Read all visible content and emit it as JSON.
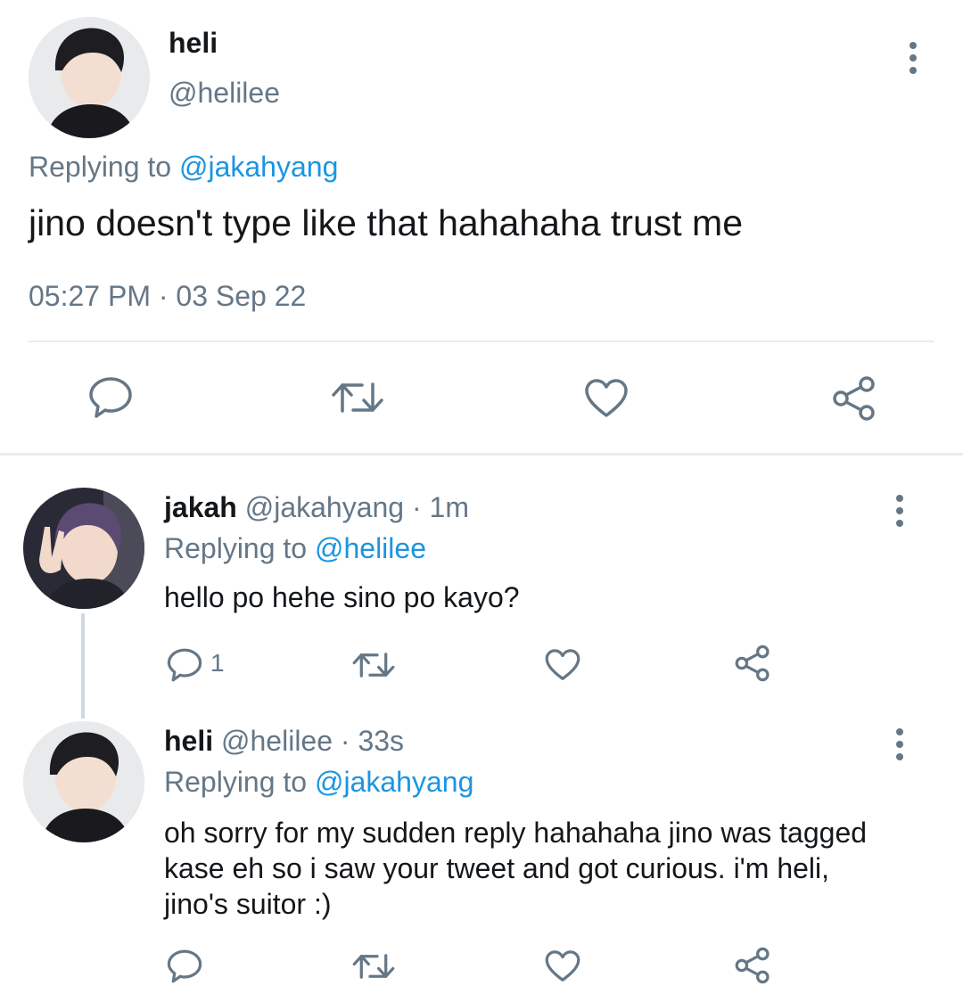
{
  "main_tweet": {
    "display_name": "heli",
    "handle": "@helilee",
    "replying_prefix": "Replying to",
    "replying_handle": "@jakahyang",
    "text": "jino doesn't type like that hahahaha trust me",
    "timestamp": "05:27 PM · 03 Sep 22",
    "actions": [
      "reply-icon",
      "retweet-icon",
      "like-icon",
      "share-icon"
    ]
  },
  "replies": [
    {
      "display_name": "jakah",
      "meta": "@jakahyang · 1m",
      "replying_prefix": "Replying to",
      "replying_handle": "@helilee",
      "text": "hello po hehe sino po kayo?",
      "reply_count": "1"
    },
    {
      "display_name": "heli",
      "meta": "@helilee · 33s",
      "replying_prefix": "Replying to",
      "replying_handle": "@jakahyang",
      "text_lines": [
        "oh sorry for my sudden reply hahahaha jino was tagged",
        "kase eh so i saw your tweet and got curious. i'm heli,",
        "jino's suitor :)"
      ],
      "reply_count": ""
    }
  ],
  "colors": {
    "text": "#14171a",
    "secondary": "#657786",
    "link": "#1b95e0",
    "divider": "#e6ecf0"
  }
}
